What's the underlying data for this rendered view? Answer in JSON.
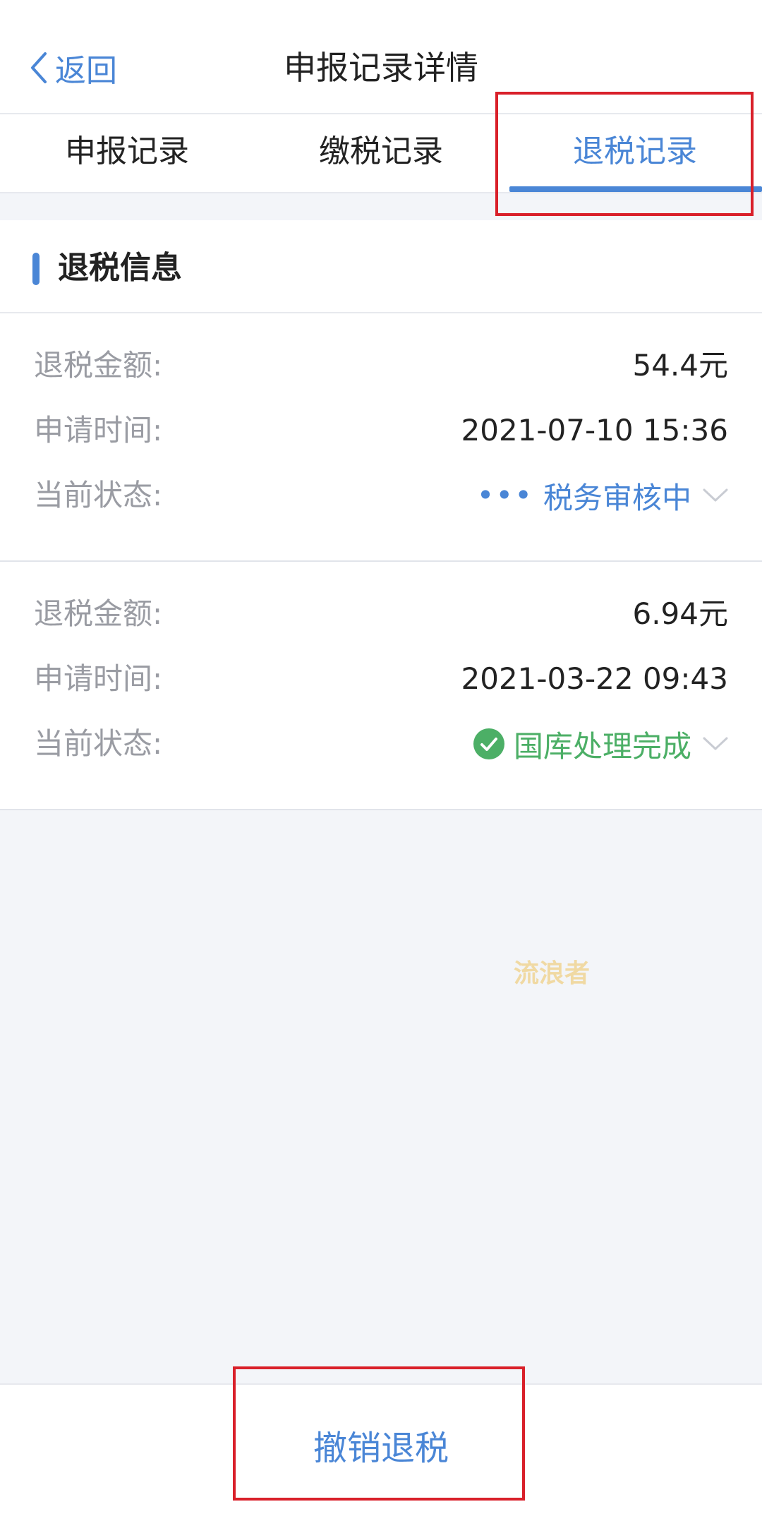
{
  "header": {
    "back_label": "返回",
    "title": "申报记录详情"
  },
  "tabs": [
    {
      "label": "申报记录",
      "active": false
    },
    {
      "label": "缴税记录",
      "active": false
    },
    {
      "label": "退税记录",
      "active": true
    }
  ],
  "section": {
    "title": "退税信息"
  },
  "records": [
    {
      "amount_label": "退税金额:",
      "amount_value": "54.4元",
      "time_label": "申请时间:",
      "time_value": "2021-07-10 15:36",
      "status_label": "当前状态:",
      "status_prefix": "•••",
      "status_value": "税务审核中",
      "status_icon": "dots-icon"
    },
    {
      "amount_label": "退税金额:",
      "amount_value": "6.94元",
      "time_label": "申请时间:",
      "time_value": "2021-03-22 09:43",
      "status_label": "当前状态:",
      "status_value": "国库处理完成",
      "status_icon": "check-circle-icon"
    }
  ],
  "watermark": "流浪者",
  "footer": {
    "cancel_label": "撤销退税"
  },
  "colors": {
    "accent": "#4a86d6",
    "success": "#4caf66",
    "highlight": "#d9202a"
  }
}
